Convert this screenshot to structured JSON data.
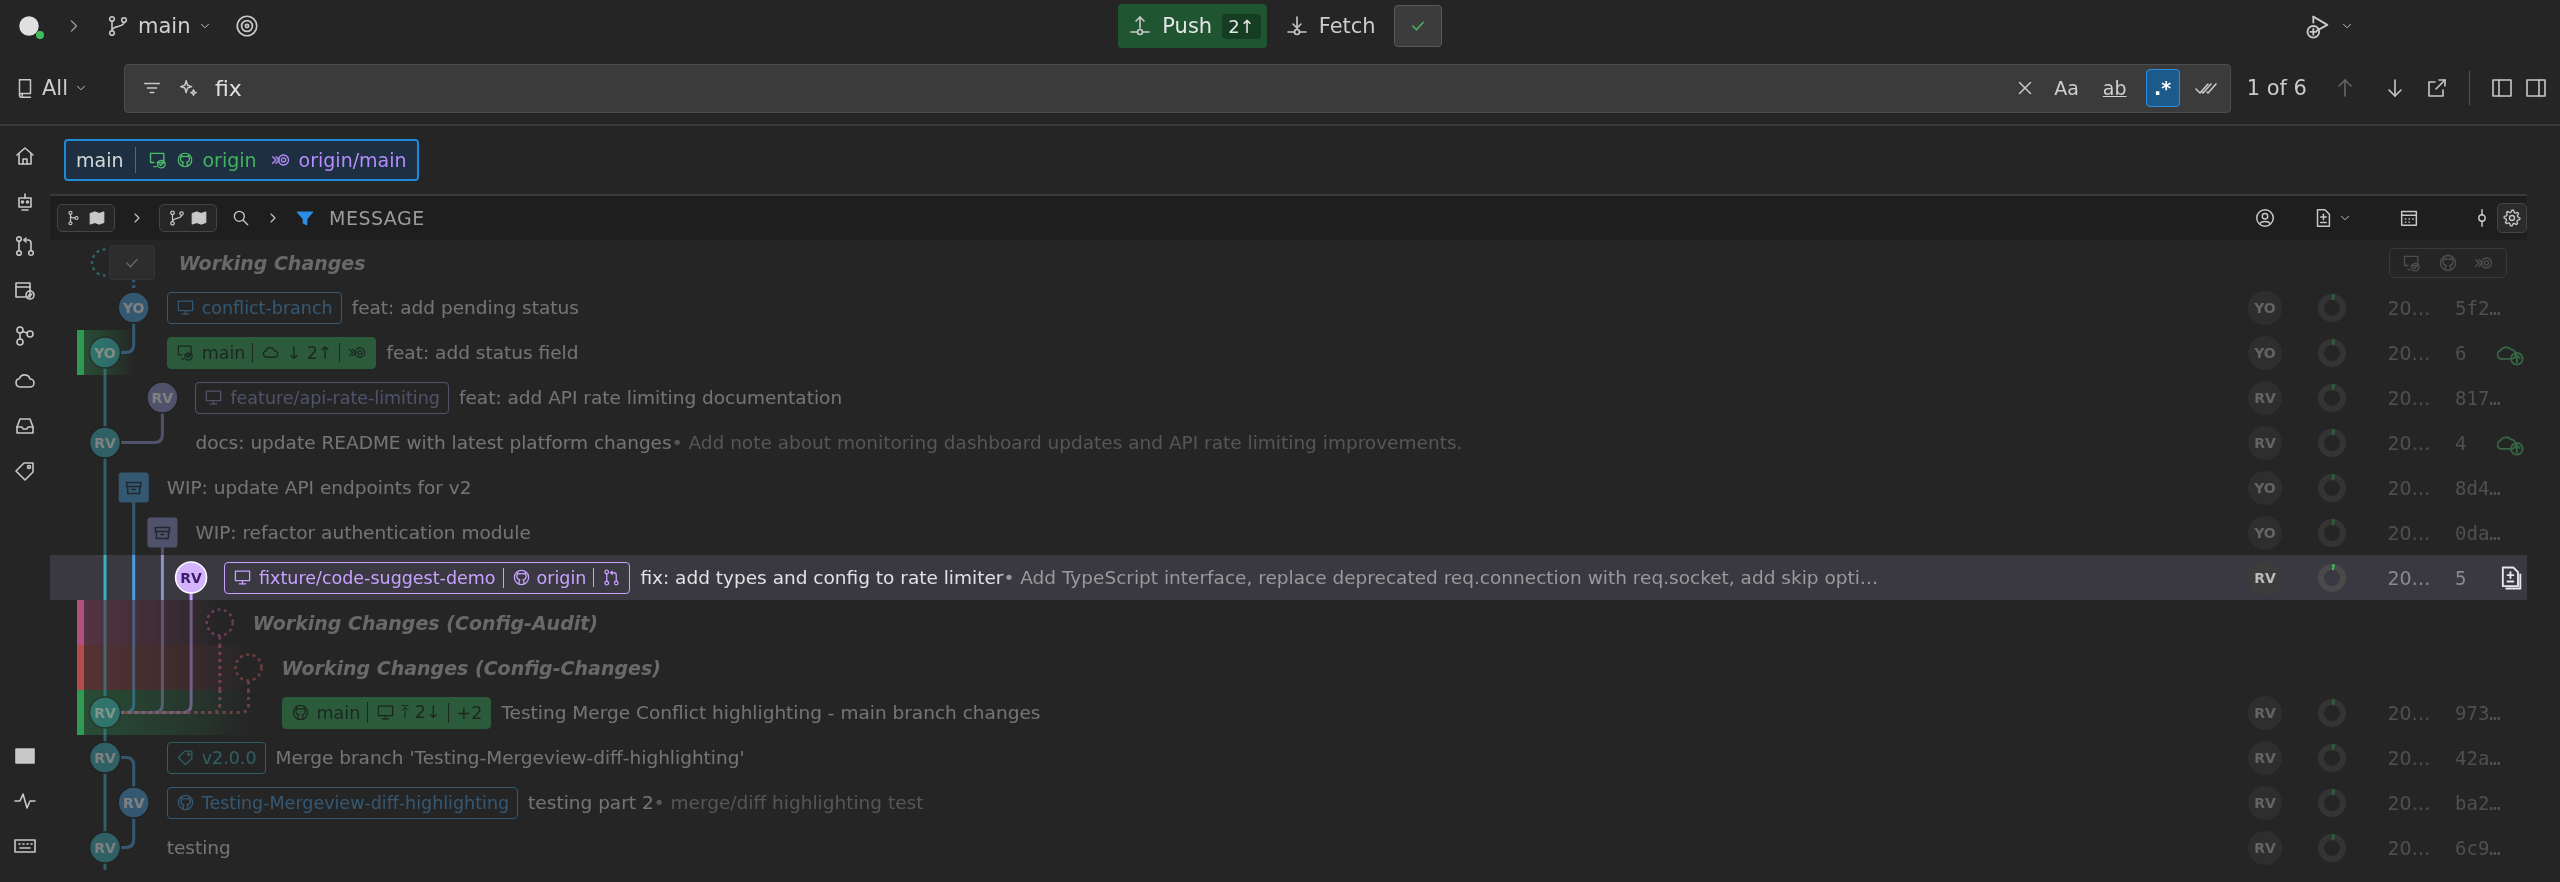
{
  "toolbar": {
    "branch": "main",
    "push": {
      "label": "Push",
      "count": "2↑"
    },
    "fetch": {
      "label": "Fetch"
    }
  },
  "search": {
    "scope": "All",
    "value": "fix",
    "toggles": [
      {
        "kind": "case",
        "label": "Aa",
        "selected": false
      },
      {
        "kind": "word",
        "label": "ab",
        "selected": false
      },
      {
        "kind": "regex",
        "label": ".*",
        "selected": true
      }
    ],
    "result": "1 of 6",
    "nav": [
      {
        "kind": "prev",
        "disabled": true
      },
      {
        "kind": "next",
        "disabled": false
      }
    ]
  },
  "ref_bar": {
    "branch": "main",
    "upstream": "origin",
    "remote_branch": "origin/main"
  },
  "header": {
    "view_toggles": [
      {
        "kind": "graph",
        "on": true
      },
      {
        "kind": "branch",
        "on": true
      }
    ],
    "message_column": "MESSAGE"
  },
  "rows": [
    {
      "kind": "working",
      "matched": false,
      "selected": false,
      "title": "Working Changes",
      "checkbox": true,
      "status_icons": true
    },
    {
      "kind": "commit",
      "matched": false,
      "selected": false,
      "avatar": "YO",
      "refs": [
        {
          "kind": "local",
          "head": false,
          "name": "conflict-branch"
        }
      ],
      "message": "feat: add pending status",
      "author": "YO",
      "date": "20…",
      "sha": "5f2…",
      "unpushed": false
    },
    {
      "kind": "commit",
      "matched": false,
      "selected": false,
      "color": "#2f9a52",
      "avatar": "YO",
      "refs": [
        {
          "kind": "local",
          "head": true,
          "name": "main",
          "parts": [
            {
              "kind": "cloud",
              "text": "↓ 2↑"
            },
            {
              "kind": "remote"
            }
          ]
        }
      ],
      "message": "feat: add status field",
      "author": "YO",
      "date": "20…",
      "sha": "6",
      "unpushed": true
    },
    {
      "kind": "commit",
      "matched": false,
      "selected": false,
      "avatar": "RV",
      "refs": [
        {
          "kind": "local",
          "head": false,
          "name": "feature/api-rate-limiting"
        }
      ],
      "message": "feat: add API rate limiting documentation",
      "author": "RV",
      "date": "20…",
      "sha": "817…",
      "unpushed": false
    },
    {
      "kind": "commit",
      "matched": false,
      "selected": false,
      "avatar": "RV",
      "message": "docs: update README with latest platform changes",
      "description": "• Add note about monitoring dashboard updates and API rate limiting improvements.",
      "author": "RV",
      "date": "20…",
      "sha": "4",
      "unpushed": true
    },
    {
      "kind": "stash",
      "matched": false,
      "selected": false,
      "message": "WIP: update API endpoints for v2",
      "author": "YO",
      "date": "20…",
      "sha": "8d4…"
    },
    {
      "kind": "stash",
      "matched": false,
      "selected": false,
      "message": "WIP: refactor authentication module",
      "author": "YO",
      "date": "20…",
      "sha": "0da…"
    },
    {
      "kind": "commit",
      "matched": true,
      "selected": true,
      "avatar": "RV",
      "refs": [
        {
          "kind": "local",
          "head": false,
          "name": "fixture/code-suggest-demo",
          "parts": [
            {
              "kind": "github",
              "text": "origin"
            },
            {
              "kind": "pr"
            }
          ]
        }
      ],
      "message": "fix: add types and config to rate limiter",
      "description": "• Add TypeScript interface, replace deprecated req.connection with req.socket, add skip opti…",
      "author": "RV",
      "date": "20…",
      "sha": "5",
      "unpushed": false
    },
    {
      "kind": "working",
      "matched": false,
      "selected": false,
      "color": "#b4507c",
      "title": "Working Changes (Config-Audit)",
      "checkbox": false,
      "status_icons": false
    },
    {
      "kind": "working",
      "matched": false,
      "selected": false,
      "color": "#b44c4c",
      "title": "Working Changes (Config-Changes)",
      "checkbox": false,
      "status_icons": false
    },
    {
      "kind": "commit",
      "matched": false,
      "selected": false,
      "color": "#2f9a52",
      "avatar": "RV",
      "refs": [
        {
          "kind": "remote",
          "head": true,
          "name": "main",
          "parts": [
            {
              "kind": "monitor",
              "text": "⤒ 2↓"
            },
            {
              "kind": "text",
              "text": "+2"
            }
          ]
        }
      ],
      "message": "Testing Merge Conflict highlighting - main branch changes",
      "author": "RV",
      "date": "20…",
      "sha": "973…",
      "unpushed": false
    },
    {
      "kind": "commit",
      "matched": false,
      "selected": false,
      "avatar": "RV",
      "refs": [
        {
          "kind": "tag",
          "head": false,
          "name": "v2.0.0"
        }
      ],
      "message": "Merge branch 'Testing-Mergeview-diff-highlighting'",
      "author": "RV",
      "date": "20…",
      "sha": "42a…",
      "unpushed": false
    },
    {
      "kind": "commit",
      "matched": false,
      "selected": false,
      "avatar": "RV",
      "refs": [
        {
          "kind": "remote",
          "head": false,
          "name": "Testing-Mergeview-diff-highlighting"
        }
      ],
      "message": "testing part 2",
      "description": "• merge/diff highlighting test",
      "author": "RV",
      "date": "20…",
      "sha": "ba2…",
      "unpushed": false
    },
    {
      "kind": "commit",
      "matched": false,
      "selected": false,
      "avatar": "RV",
      "message": "testing",
      "author": "RV",
      "date": "20…",
      "sha": "6c9…",
      "unpushed": false
    }
  ]
}
